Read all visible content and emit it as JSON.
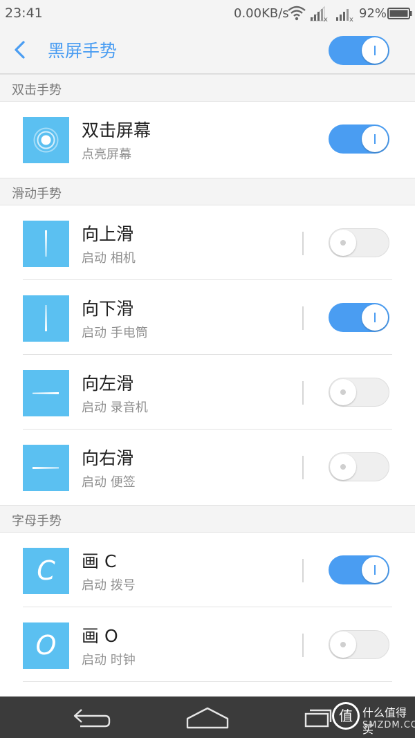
{
  "status_bar": {
    "time": "23:41",
    "network_speed": "0.00KB/s",
    "battery_percent": "92%"
  },
  "header": {
    "title": "黑屏手势",
    "master_toggle_on": true
  },
  "sections": [
    {
      "title": "双击手势",
      "items": [
        {
          "title": "双击屏幕",
          "subtitle": "点亮屏幕",
          "icon": "double-tap-icon",
          "enabled": true
        }
      ]
    },
    {
      "title": "滑动手势",
      "items": [
        {
          "title": "向上滑",
          "subtitle": "启动 相机",
          "icon": "swipe-up-icon",
          "enabled": false
        },
        {
          "title": "向下滑",
          "subtitle": "启动 手电筒",
          "icon": "swipe-down-icon",
          "enabled": true
        },
        {
          "title": "向左滑",
          "subtitle": "启动 录音机",
          "icon": "swipe-left-icon",
          "enabled": false
        },
        {
          "title": "向右滑",
          "subtitle": "启动 便签",
          "icon": "swipe-right-icon",
          "enabled": false
        }
      ]
    },
    {
      "title": "字母手势",
      "items": [
        {
          "title": "画 C",
          "subtitle": "启动 拨号",
          "icon": "letter-c-icon",
          "icon_letter": "C",
          "enabled": true
        },
        {
          "title": "画 O",
          "subtitle": "启动 时钟",
          "icon": "letter-o-icon",
          "icon_letter": "O",
          "enabled": false
        }
      ]
    }
  ],
  "watermark": {
    "logo_char": "值",
    "text_cn": "什么值得买",
    "text_en": "SMZDM.COM"
  },
  "colors": {
    "accent": "#4a9df2",
    "tile": "#5bc0f1",
    "header_bg": "#f4f4f4",
    "nav_bg": "#3b3b3b"
  }
}
